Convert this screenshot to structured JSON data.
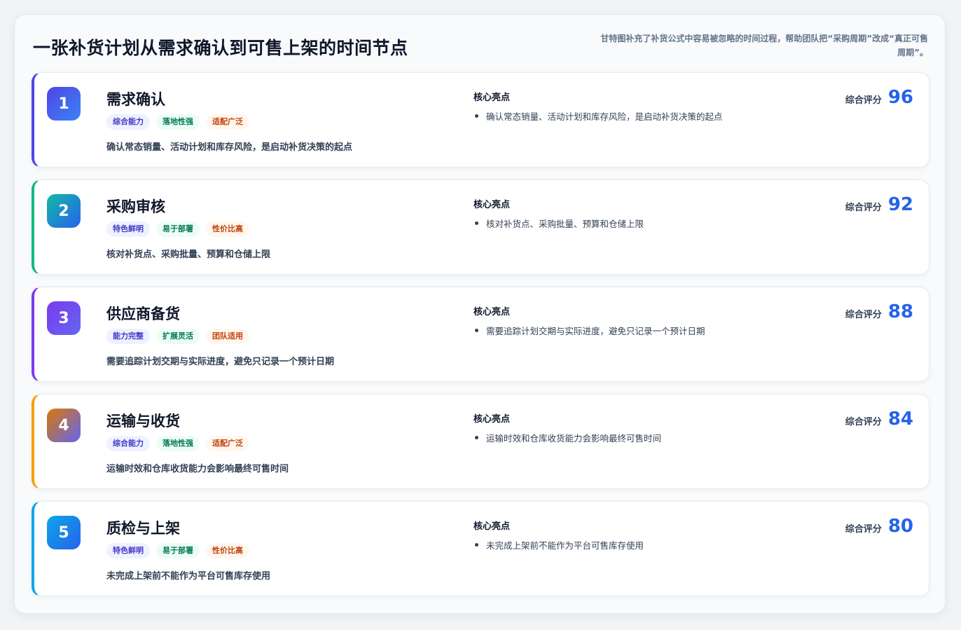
{
  "header": {
    "title": "一张补货计划从需求确认到可售上架的时间节点",
    "subtitle": "甘特图补充了补货公式中容易被忽略的时间过程，帮助团队把“采购周期”改成“真正可售周期”。"
  },
  "labels": {
    "highlights": "核心亮点",
    "score": "综合评分"
  },
  "stages": [
    {
      "number": "1",
      "name": "需求确认",
      "tags": [
        "综合能力",
        "落地性强",
        "适配广泛"
      ],
      "description": "确认常态销量、活动计划和库存风险，是启动补货决策的起点",
      "highlight": "确认常态销量、活动计划和库存风险，是启动补货决策的起点",
      "score": "96",
      "accent": "#4f46e5",
      "badge_gradient": [
        "#4f46e5",
        "#3b82f6"
      ]
    },
    {
      "number": "2",
      "name": "采购审核",
      "tags": [
        "特色鲜明",
        "易于部署",
        "性价比高"
      ],
      "description": "核对补货点、采购批量、预算和仓储上限",
      "highlight": "核对补货点、采购批量、预算和仓储上限",
      "score": "92",
      "accent": "#10b981",
      "badge_gradient": [
        "#14b8a6",
        "#2563eb"
      ]
    },
    {
      "number": "3",
      "name": "供应商备货",
      "tags": [
        "能力完整",
        "扩展灵活",
        "团队适用"
      ],
      "description": "需要追踪计划交期与实际进度，避免只记录一个预计日期",
      "highlight": "需要追踪计划交期与实际进度，避免只记录一个预计日期",
      "score": "88",
      "accent": "#7c3aed",
      "badge_gradient": [
        "#7c3aed",
        "#6366f1"
      ]
    },
    {
      "number": "4",
      "name": "运输与收货",
      "tags": [
        "综合能力",
        "落地性强",
        "适配广泛"
      ],
      "description": "运输时效和仓库收货能力会影响最终可售时间",
      "highlight": "运输时效和仓库收货能力会影响最终可售时间",
      "score": "84",
      "accent": "#f59e0b",
      "badge_gradient": [
        "#d97706",
        "#6366f1"
      ]
    },
    {
      "number": "5",
      "name": "质检与上架",
      "tags": [
        "特色鲜明",
        "易于部署",
        "性价比高"
      ],
      "description": "未完成上架前不能作为平台可售库存使用",
      "highlight": "未完成上架前不能作为平台可售库存使用",
      "score": "80",
      "accent": "#0ea5e9",
      "badge_gradient": [
        "#0ea5e9",
        "#2563eb"
      ]
    }
  ]
}
